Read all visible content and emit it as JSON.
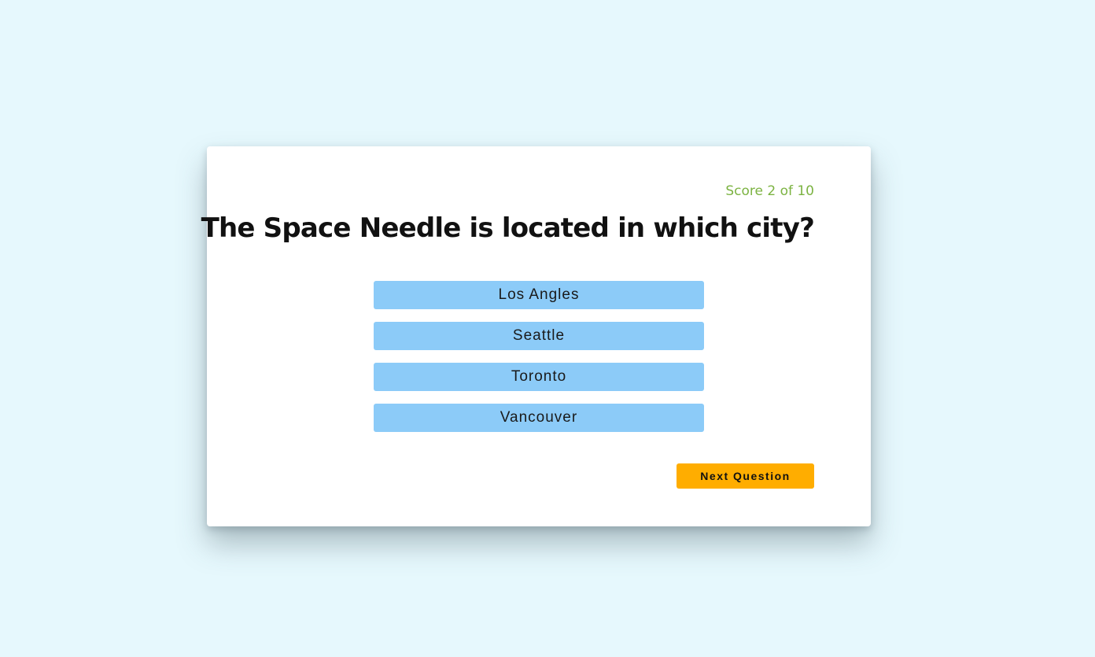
{
  "quiz": {
    "score_text": "Score 2 of 10",
    "question": "The Space Needle is located in which city?",
    "answers": [
      {
        "label": "Los Angles"
      },
      {
        "label": "Seattle"
      },
      {
        "label": "Toronto"
      },
      {
        "label": "Vancouver"
      }
    ],
    "next_label": "Next Question"
  },
  "colors": {
    "background": "#e6f8fd",
    "card": "#ffffff",
    "score": "#7cb342",
    "answer_button": "#8ccbf8",
    "next_button": "#ffad00"
  }
}
